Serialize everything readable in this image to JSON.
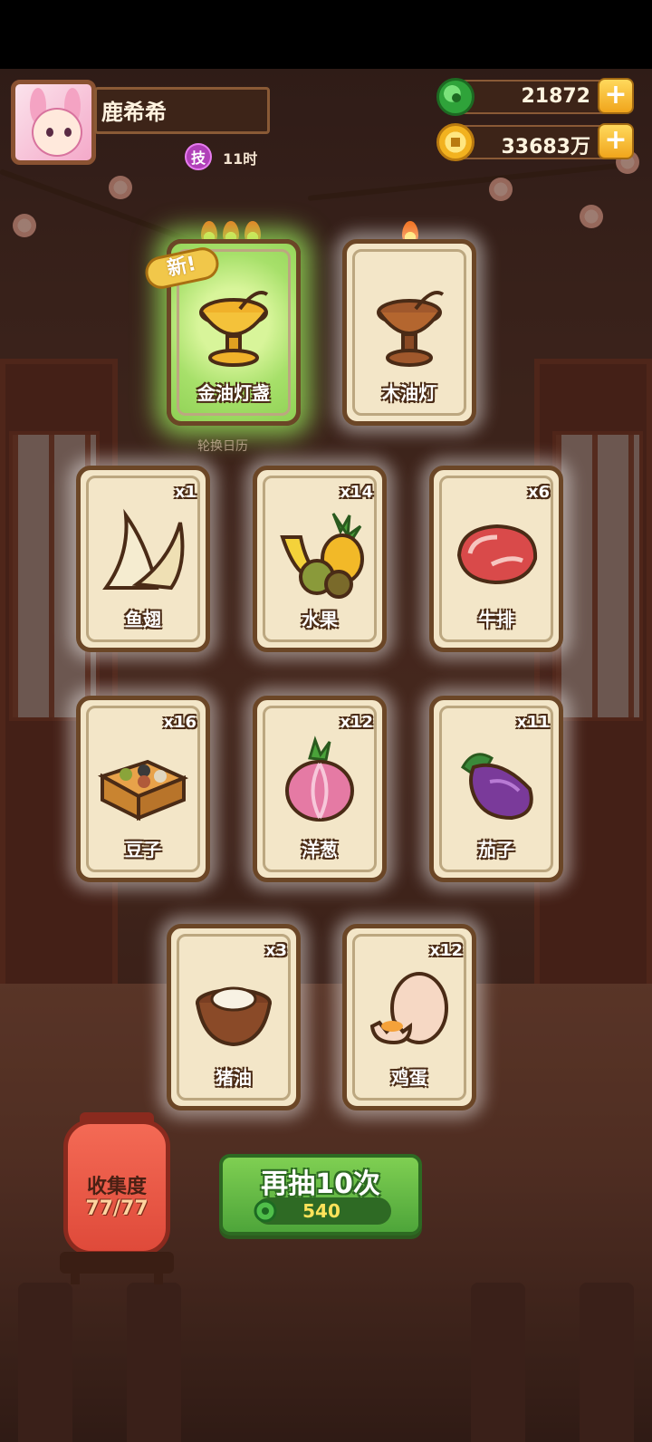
{
  "player": {
    "name": "鹿希希",
    "skill_icon": "技",
    "skill_time": "11时"
  },
  "currency": {
    "jade": {
      "icon": "jade-icon",
      "value": "21872"
    },
    "coins": {
      "icon": "coin-icon",
      "value": "33683万"
    },
    "plus": "+"
  },
  "special_cards": [
    {
      "label": "金油灯盏",
      "flames": 3,
      "is_new": true,
      "new_tag": "新!",
      "icon": "golden-lamp-icon"
    },
    {
      "label": "木油灯",
      "flames": 1,
      "is_new": false,
      "icon": "wooden-lamp-icon"
    }
  ],
  "calendar_text": "轮换日历",
  "item_cards": [
    {
      "label": "鱼翅",
      "count": "x1",
      "icon": "shark-fin-icon"
    },
    {
      "label": "水果",
      "count": "x14",
      "icon": "fruit-icon"
    },
    {
      "label": "牛排",
      "count": "x6",
      "icon": "steak-icon"
    },
    {
      "label": "豆子",
      "count": "x16",
      "icon": "beans-icon"
    },
    {
      "label": "洋葱",
      "count": "x12",
      "icon": "onion-icon"
    },
    {
      "label": "茄子",
      "count": "x11",
      "icon": "eggplant-icon"
    },
    {
      "label": "猪油",
      "count": "x3",
      "icon": "lard-icon"
    },
    {
      "label": "鸡蛋",
      "count": "x12",
      "icon": "egg-icon"
    }
  ],
  "collection": {
    "title": "收集度",
    "value": "77/77"
  },
  "draw_button": {
    "label": "再抽10次",
    "cost": "540",
    "cost_icon": "jade-icon"
  },
  "colors": {
    "card_bg": "#f3e6c8",
    "card_border": "#6b4626",
    "glow_green": "#9aea5c",
    "button_green": "#4ea53a",
    "lantern_red": "#df4a3a"
  }
}
